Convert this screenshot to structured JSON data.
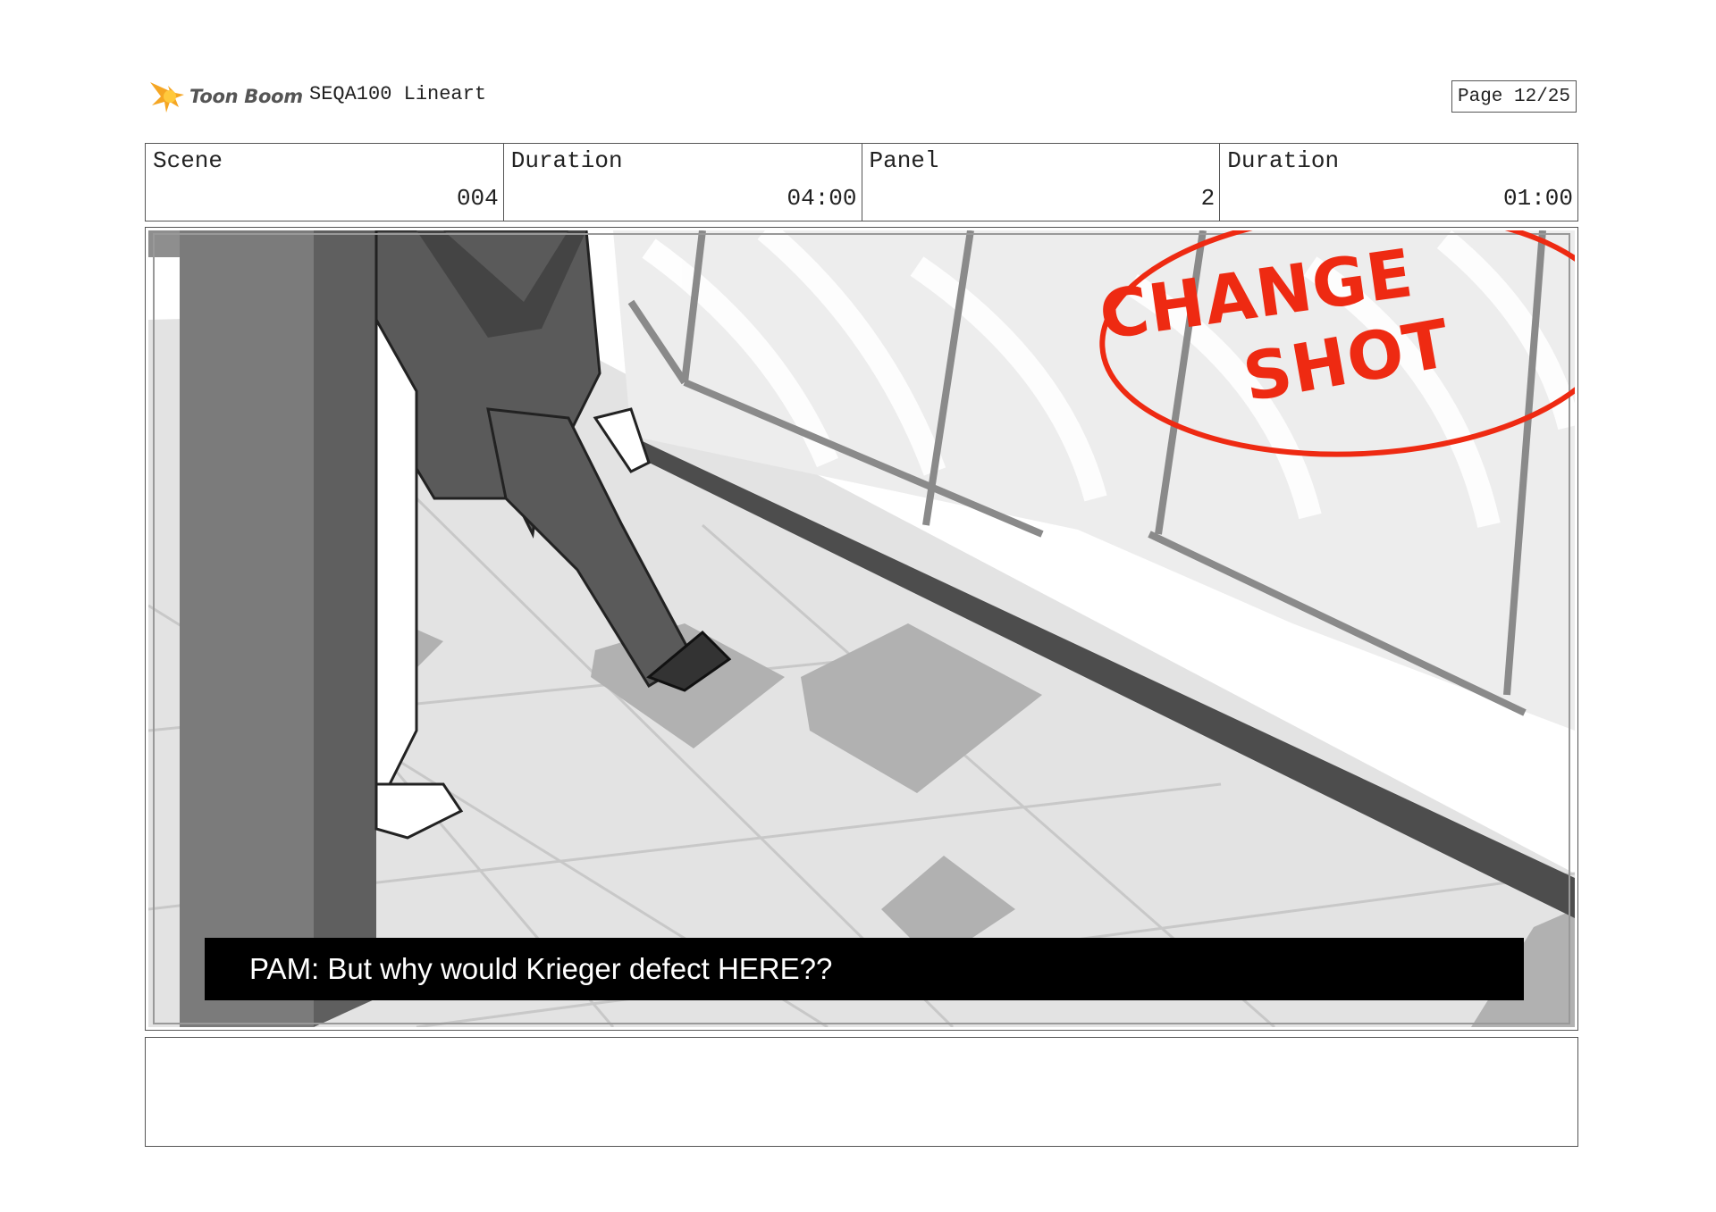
{
  "header": {
    "logo_text": "Toon Boom",
    "project_title": "SEQA100 Lineart",
    "page_label": "Page 12/25"
  },
  "info": {
    "scene_label": "Scene",
    "scene_value": "004",
    "scene_duration_label": "Duration",
    "scene_duration_value": "04:00",
    "panel_label": "Panel",
    "panel_value": "2",
    "panel_duration_label": "Duration",
    "panel_duration_value": "01:00"
  },
  "panel": {
    "caption": "PAM: But why would Krieger defect HERE??",
    "annotation_line1": "CHANGE",
    "annotation_line2": "SHOT",
    "annotation_color": "#ee2a12"
  },
  "notes": {
    "text": ""
  },
  "colors": {
    "logo_star": "#f5a623",
    "border": "#555555",
    "caption_bg": "#000000"
  }
}
